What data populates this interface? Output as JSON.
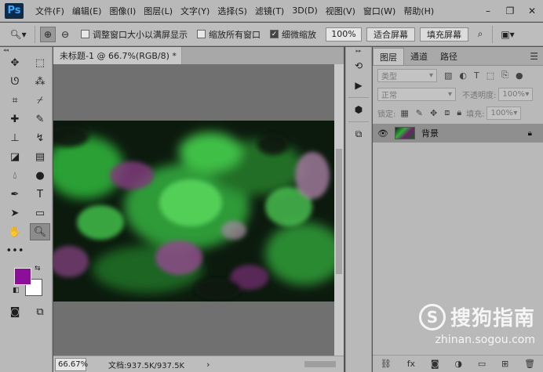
{
  "app": {
    "logo": "Ps"
  },
  "menu": [
    "文件(F)",
    "编辑(E)",
    "图像(I)",
    "图层(L)",
    "文字(Y)",
    "选择(S)",
    "滤镜(T)",
    "3D(D)",
    "视图(V)",
    "窗口(W)",
    "帮助(H)"
  ],
  "options": {
    "checkbox_resize": "调整窗口大小以满屏显示",
    "checkbox_zoom_all": "缩放所有窗口",
    "checkbox_scrubby": "细微缩放",
    "zoom_value": "100%",
    "fit_screen": "适合屏幕",
    "fill_screen": "填充屏幕"
  },
  "document": {
    "tab_title": "未标题-1 @ 66.7%(RGB/8) *",
    "zoom": "66.67%",
    "doc_info": "文档:937.5K/937.5K"
  },
  "colors": {
    "foreground": "#8c0f99",
    "background": "#ffffff"
  },
  "layers_panel": {
    "tabs": [
      "图层",
      "通道",
      "路径"
    ],
    "filter_label": "类型",
    "blend_mode": "正常",
    "opacity_label": "不透明度:",
    "opacity_value": "100%",
    "lock_label": "锁定:",
    "fill_label": "填充:",
    "fill_value": "100%",
    "layer_name": "背景"
  },
  "watermark": {
    "brand": "搜狗指南",
    "url": "zhinan.sogou.com"
  }
}
